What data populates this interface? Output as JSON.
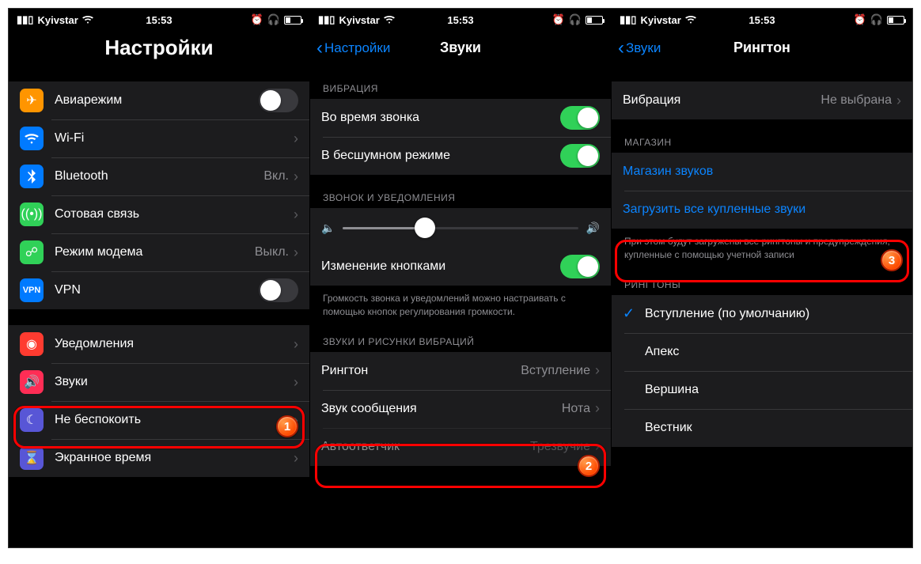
{
  "statusbar": {
    "carrier": "Kyivstar",
    "time": "15:53"
  },
  "panel1": {
    "title": "Настройки",
    "rows": [
      {
        "icon": "airplane",
        "label": "Авиарежим",
        "toggle": false
      },
      {
        "icon": "wifi",
        "label": "Wi-Fi",
        "value": " ",
        "chev": true
      },
      {
        "icon": "bluetooth",
        "label": "Bluetooth",
        "value": "Вкл.",
        "chev": true
      },
      {
        "icon": "cellular",
        "label": "Сотовая связь",
        "chev": true
      },
      {
        "icon": "hotspot",
        "label": "Режим модема",
        "value": "Выкл.",
        "chev": true
      },
      {
        "icon": "vpn",
        "label": "VPN",
        "toggle": false
      }
    ],
    "rows2": [
      {
        "icon": "notif",
        "label": "Уведомления",
        "chev": true
      },
      {
        "icon": "sounds",
        "label": "Звуки",
        "chev": true
      },
      {
        "icon": "dnd",
        "label": "Не беспокоить",
        "chev": true
      },
      {
        "icon": "screentime",
        "label": "Экранное время",
        "chev": true
      }
    ]
  },
  "panel2": {
    "back": "Настройки",
    "title": "Звуки",
    "vibration_header": "ВИБРАЦИЯ",
    "vib_rows": [
      {
        "label": "Во время звонка",
        "toggle": true
      },
      {
        "label": "В бесшумном режиме",
        "toggle": true
      }
    ],
    "volume_header": "ЗВОНОК И УВЕДОМЛЕНИЯ",
    "volume_change_label": "Изменение кнопками",
    "volume_footer": "Громкость звонка и уведомлений можно настраивать с помощью кнопок регулирования громкости.",
    "sounds_header": "ЗВУКИ И РИСУНКИ ВИБРАЦИЙ",
    "sound_rows": [
      {
        "label": "Рингтон",
        "value": "Вступление"
      },
      {
        "label": "Звук сообщения",
        "value": "Нота"
      },
      {
        "label": "Автоответчик",
        "value": "Трезвучие"
      }
    ]
  },
  "panel3": {
    "back": "Звуки",
    "title": "Рингтон",
    "vibration_label": "Вибрация",
    "vibration_value": "Не выбрана",
    "store_header": "МАГАЗИН",
    "store_row1": "Магазин звуков",
    "store_row2": "Загрузить все купленные звуки",
    "store_footer": "При этом будут загружены все рингтоны и предупреждения, купленные с помощью учетной записи",
    "ringtones_header": "РИНГТОНЫ",
    "ringtones": [
      {
        "label": "Вступление (по умолчанию)",
        "selected": true
      },
      {
        "label": "Апекс"
      },
      {
        "label": "Вершина"
      },
      {
        "label": "Вестник"
      }
    ]
  },
  "badges": {
    "1": "1",
    "2": "2",
    "3": "3"
  }
}
